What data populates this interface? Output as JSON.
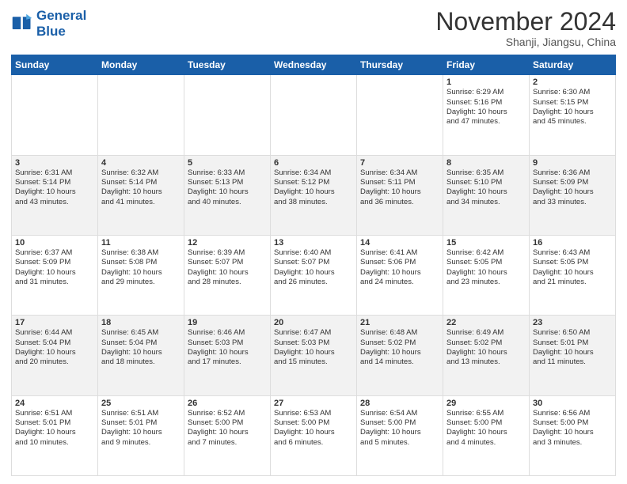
{
  "logo": {
    "line1": "General",
    "line2": "Blue"
  },
  "title": "November 2024",
  "location": "Shanji, Jiangsu, China",
  "days_header": [
    "Sunday",
    "Monday",
    "Tuesday",
    "Wednesday",
    "Thursday",
    "Friday",
    "Saturday"
  ],
  "weeks": [
    [
      {
        "day": "",
        "text": ""
      },
      {
        "day": "",
        "text": ""
      },
      {
        "day": "",
        "text": ""
      },
      {
        "day": "",
        "text": ""
      },
      {
        "day": "",
        "text": ""
      },
      {
        "day": "1",
        "text": "Sunrise: 6:29 AM\nSunset: 5:16 PM\nDaylight: 10 hours\nand 47 minutes."
      },
      {
        "day": "2",
        "text": "Sunrise: 6:30 AM\nSunset: 5:15 PM\nDaylight: 10 hours\nand 45 minutes."
      }
    ],
    [
      {
        "day": "3",
        "text": "Sunrise: 6:31 AM\nSunset: 5:14 PM\nDaylight: 10 hours\nand 43 minutes."
      },
      {
        "day": "4",
        "text": "Sunrise: 6:32 AM\nSunset: 5:14 PM\nDaylight: 10 hours\nand 41 minutes."
      },
      {
        "day": "5",
        "text": "Sunrise: 6:33 AM\nSunset: 5:13 PM\nDaylight: 10 hours\nand 40 minutes."
      },
      {
        "day": "6",
        "text": "Sunrise: 6:34 AM\nSunset: 5:12 PM\nDaylight: 10 hours\nand 38 minutes."
      },
      {
        "day": "7",
        "text": "Sunrise: 6:34 AM\nSunset: 5:11 PM\nDaylight: 10 hours\nand 36 minutes."
      },
      {
        "day": "8",
        "text": "Sunrise: 6:35 AM\nSunset: 5:10 PM\nDaylight: 10 hours\nand 34 minutes."
      },
      {
        "day": "9",
        "text": "Sunrise: 6:36 AM\nSunset: 5:09 PM\nDaylight: 10 hours\nand 33 minutes."
      }
    ],
    [
      {
        "day": "10",
        "text": "Sunrise: 6:37 AM\nSunset: 5:09 PM\nDaylight: 10 hours\nand 31 minutes."
      },
      {
        "day": "11",
        "text": "Sunrise: 6:38 AM\nSunset: 5:08 PM\nDaylight: 10 hours\nand 29 minutes."
      },
      {
        "day": "12",
        "text": "Sunrise: 6:39 AM\nSunset: 5:07 PM\nDaylight: 10 hours\nand 28 minutes."
      },
      {
        "day": "13",
        "text": "Sunrise: 6:40 AM\nSunset: 5:07 PM\nDaylight: 10 hours\nand 26 minutes."
      },
      {
        "day": "14",
        "text": "Sunrise: 6:41 AM\nSunset: 5:06 PM\nDaylight: 10 hours\nand 24 minutes."
      },
      {
        "day": "15",
        "text": "Sunrise: 6:42 AM\nSunset: 5:05 PM\nDaylight: 10 hours\nand 23 minutes."
      },
      {
        "day": "16",
        "text": "Sunrise: 6:43 AM\nSunset: 5:05 PM\nDaylight: 10 hours\nand 21 minutes."
      }
    ],
    [
      {
        "day": "17",
        "text": "Sunrise: 6:44 AM\nSunset: 5:04 PM\nDaylight: 10 hours\nand 20 minutes."
      },
      {
        "day": "18",
        "text": "Sunrise: 6:45 AM\nSunset: 5:04 PM\nDaylight: 10 hours\nand 18 minutes."
      },
      {
        "day": "19",
        "text": "Sunrise: 6:46 AM\nSunset: 5:03 PM\nDaylight: 10 hours\nand 17 minutes."
      },
      {
        "day": "20",
        "text": "Sunrise: 6:47 AM\nSunset: 5:03 PM\nDaylight: 10 hours\nand 15 minutes."
      },
      {
        "day": "21",
        "text": "Sunrise: 6:48 AM\nSunset: 5:02 PM\nDaylight: 10 hours\nand 14 minutes."
      },
      {
        "day": "22",
        "text": "Sunrise: 6:49 AM\nSunset: 5:02 PM\nDaylight: 10 hours\nand 13 minutes."
      },
      {
        "day": "23",
        "text": "Sunrise: 6:50 AM\nSunset: 5:01 PM\nDaylight: 10 hours\nand 11 minutes."
      }
    ],
    [
      {
        "day": "24",
        "text": "Sunrise: 6:51 AM\nSunset: 5:01 PM\nDaylight: 10 hours\nand 10 minutes."
      },
      {
        "day": "25",
        "text": "Sunrise: 6:51 AM\nSunset: 5:01 PM\nDaylight: 10 hours\nand 9 minutes."
      },
      {
        "day": "26",
        "text": "Sunrise: 6:52 AM\nSunset: 5:00 PM\nDaylight: 10 hours\nand 7 minutes."
      },
      {
        "day": "27",
        "text": "Sunrise: 6:53 AM\nSunset: 5:00 PM\nDaylight: 10 hours\nand 6 minutes."
      },
      {
        "day": "28",
        "text": "Sunrise: 6:54 AM\nSunset: 5:00 PM\nDaylight: 10 hours\nand 5 minutes."
      },
      {
        "day": "29",
        "text": "Sunrise: 6:55 AM\nSunset: 5:00 PM\nDaylight: 10 hours\nand 4 minutes."
      },
      {
        "day": "30",
        "text": "Sunrise: 6:56 AM\nSunset: 5:00 PM\nDaylight: 10 hours\nand 3 minutes."
      }
    ]
  ]
}
